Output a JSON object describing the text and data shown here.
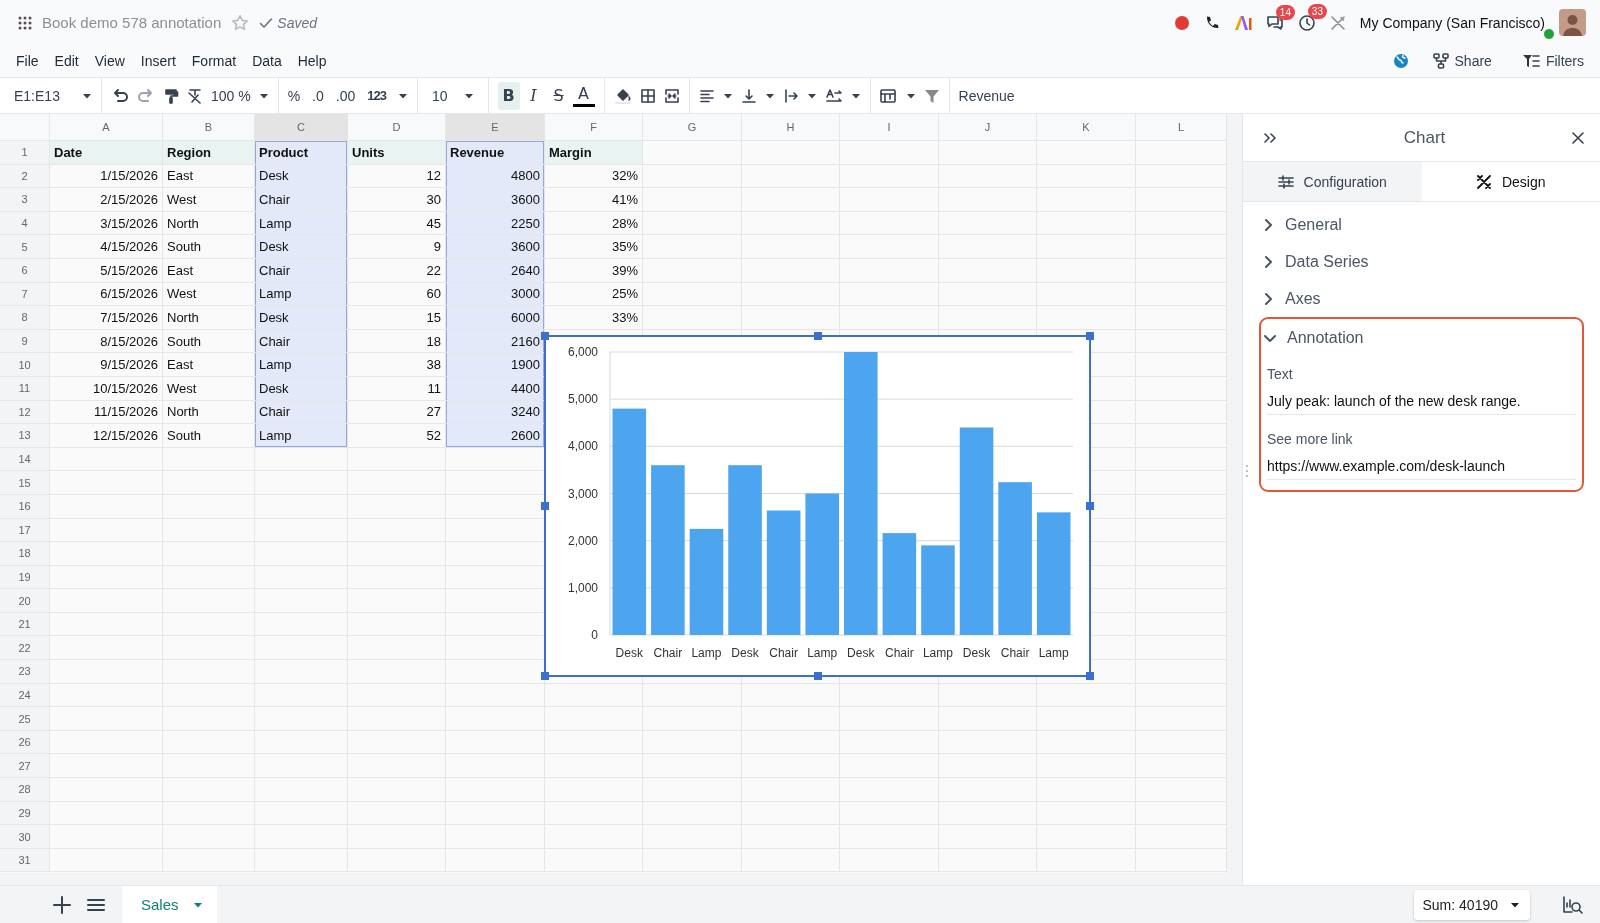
{
  "app_bar": {
    "document_title": "Book demo 578 annotation",
    "status": "Saved",
    "company": "My Company (San Francisco)",
    "notifications": [
      {
        "kind": "chat",
        "count": "14"
      },
      {
        "kind": "activity",
        "count": "33"
      }
    ]
  },
  "menu": [
    "File",
    "Edit",
    "View",
    "Insert",
    "Format",
    "Data",
    "Help"
  ],
  "actions": [
    {
      "kind": "share",
      "label": "Share"
    },
    {
      "kind": "filters",
      "label": "Filters"
    }
  ],
  "toolbar": {
    "cell_range": "E1:E13",
    "zoom": "100 %",
    "number_formats": [
      "%",
      ".0",
      ".00",
      "123"
    ],
    "font_size": "10",
    "text_styles": [
      {
        "kind": "bold",
        "label": "B",
        "selected": true
      },
      {
        "kind": "italic",
        "label": "I",
        "selected": false
      },
      {
        "kind": "strike",
        "label": "S",
        "selected": false
      },
      {
        "kind": "color",
        "label": "A",
        "selected": false
      }
    ],
    "formula": "Revenue"
  },
  "sheet": {
    "columns": [
      {
        "label": "A",
        "selected": false
      },
      {
        "label": "B",
        "selected": false
      },
      {
        "label": "C",
        "selected": true
      },
      {
        "label": "D",
        "selected": false
      },
      {
        "label": "E",
        "selected": true
      },
      {
        "label": "F",
        "selected": false
      },
      {
        "label": "G",
        "selected": false
      },
      {
        "label": "H",
        "selected": false
      },
      {
        "label": "I",
        "selected": false
      },
      {
        "label": "J",
        "selected": false
      },
      {
        "label": "K",
        "selected": false
      },
      {
        "label": "L",
        "selected": false
      }
    ],
    "row_numbers": [
      "1",
      "2",
      "3",
      "4",
      "5",
      "6",
      "7",
      "8",
      "9",
      "10",
      "11",
      "12",
      "13",
      "14",
      "15",
      "16",
      "17",
      "18",
      "19",
      "20",
      "21",
      "22",
      "23",
      "24",
      "25",
      "26",
      "27",
      "28",
      "29",
      "30",
      "31"
    ],
    "header": [
      "Date",
      "Region",
      "Product",
      "Units",
      "Revenue",
      "Margin"
    ],
    "rows": [
      [
        "1/15/2026",
        "East",
        "Desk",
        "12",
        "4800",
        "32%"
      ],
      [
        "2/15/2026",
        "West",
        "Chair",
        "30",
        "3600",
        "41%"
      ],
      [
        "3/15/2026",
        "North",
        "Lamp",
        "45",
        "2250",
        "28%"
      ],
      [
        "4/15/2026",
        "South",
        "Desk",
        "9",
        "3600",
        "35%"
      ],
      [
        "5/15/2026",
        "East",
        "Chair",
        "22",
        "2640",
        "39%"
      ],
      [
        "6/15/2026",
        "West",
        "Lamp",
        "60",
        "3000",
        "25%"
      ],
      [
        "7/15/2026",
        "North",
        "Desk",
        "15",
        "6000",
        "33%"
      ],
      [
        "8/15/2026",
        "South",
        "Chair",
        "18",
        "2160"
      ],
      [
        "9/15/2026",
        "East",
        "Lamp",
        "38",
        "1900"
      ],
      [
        "10/15/2026",
        "West",
        "Desk",
        "11",
        "4400"
      ],
      [
        "11/15/2026",
        "North",
        "Chair",
        "27",
        "3240"
      ],
      [
        "12/15/2026",
        "South",
        "Lamp",
        "52",
        "2600"
      ]
    ]
  },
  "chart": {
    "chart_data": {
      "type": "bar",
      "categories": [
        "Desk",
        "Chair",
        "Lamp",
        "Desk",
        "Chair",
        "Lamp",
        "Desk",
        "Chair",
        "Lamp",
        "Desk",
        "Chair",
        "Lamp"
      ],
      "series": [
        {
          "color": "#4ea5ef",
          "values": [
            4800,
            3600,
            2250,
            3600,
            2640,
            3000,
            6000,
            2160,
            1900,
            4400,
            3240,
            2600
          ]
        }
      ],
      "ylim": [
        0,
        6000
      ],
      "grid": true,
      "yticks": [
        {
          "value": 0,
          "label": "0"
        },
        {
          "value": 1000,
          "label": "1,000"
        },
        {
          "value": 2000,
          "label": "2,000"
        },
        {
          "value": 3000,
          "label": "3,000"
        },
        {
          "value": 4000,
          "label": "4,000"
        },
        {
          "value": 5000,
          "label": "5,000"
        },
        {
          "value": 6000,
          "label": "6,000"
        }
      ]
    }
  },
  "side_panel": {
    "title": "Chart",
    "tabs": [
      {
        "kind": "configuration",
        "label": "Configuration",
        "selected": false
      },
      {
        "kind": "design",
        "label": "Design",
        "selected": true
      }
    ],
    "sections": [
      {
        "label": "General",
        "expanded": false,
        "highlighted": false
      },
      {
        "label": "Data Series",
        "expanded": false,
        "highlighted": false
      },
      {
        "label": "Axes",
        "expanded": false,
        "highlighted": false
      },
      {
        "label": "Annotation",
        "expanded": true,
        "highlighted": true,
        "fields": [
          {
            "label": "Text",
            "value": "July peak: launch of the new desk range."
          },
          {
            "label": "See more link",
            "value": "https://www.example.com/desk-launch"
          }
        ]
      }
    ]
  },
  "footer": {
    "sheets": [
      {
        "label": "Sales",
        "selected": true
      }
    ],
    "summary": "Sum: 40190"
  }
}
